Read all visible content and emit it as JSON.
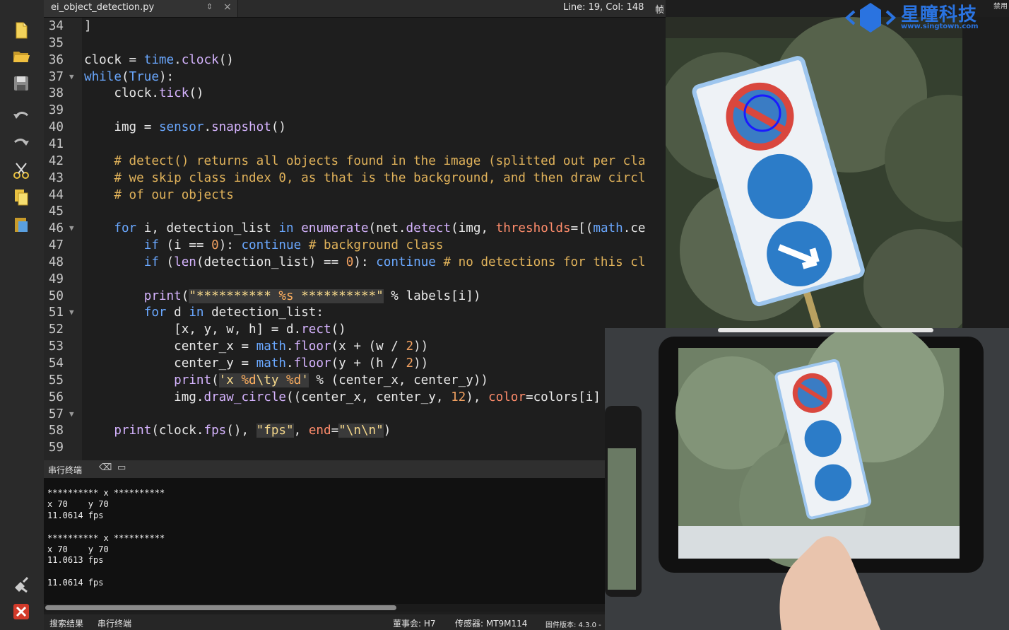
{
  "tab": {
    "title": "ei_object_detection.py",
    "arrows": "⇕",
    "close": "×"
  },
  "status_top": {
    "cursor": "Line: 19, Col: 148",
    "frame_buffer": "帧缓冲区"
  },
  "code_lines": [
    {
      "n": "34",
      "html": "]"
    },
    {
      "n": "35",
      "html": ""
    },
    {
      "n": "36",
      "html": "clock = <span class='mod'>time</span>.<span class='fn'>clock</span>()"
    },
    {
      "n": "37",
      "fold": true,
      "html": "<span class='kw'>while</span>(<span class='kw'>True</span>):"
    },
    {
      "n": "38",
      "html": "    clock.<span class='fn'>tick</span>()"
    },
    {
      "n": "39",
      "html": ""
    },
    {
      "n": "40",
      "html": "    img = <span class='mod'>sensor</span>.<span class='fn'>snapshot</span>()"
    },
    {
      "n": "41",
      "html": ""
    },
    {
      "n": "42",
      "html": "    <span class='cm'># detect() returns all objects found in the image (splitted out per cla</span>"
    },
    {
      "n": "43",
      "html": "    <span class='cm'># we skip class index 0, as that is the background, and then draw circl</span>"
    },
    {
      "n": "44",
      "html": "    <span class='cm'># of our objects</span>"
    },
    {
      "n": "45",
      "html": ""
    },
    {
      "n": "46",
      "fold": true,
      "html": "    <span class='kw'>for</span> i, detection_list <span class='kw'>in</span> <span class='fn'>enumerate</span>(net.<span class='fn'>detect</span>(img, <span class='par'>thresholds</span>=[(<span class='mod'>math</span>.ce"
    },
    {
      "n": "47",
      "html": "        <span class='kw'>if</span> (i == <span class='num'>0</span>): <span class='kw'>continue</span> <span class='cm'># background class</span>"
    },
    {
      "n": "48",
      "html": "        <span class='kw'>if</span> (<span class='fn'>len</span>(detection_list) == <span class='num'>0</span>): <span class='kw'>continue</span> <span class='cm'># no detections for this cl</span>"
    },
    {
      "n": "49",
      "html": ""
    },
    {
      "n": "50",
      "html": "        <span class='fn'>print</span>(<span class='str'>\"********** </span><span class='str fmt'>%s</span><span class='str'> **********\"</span> % labels[i])"
    },
    {
      "n": "51",
      "fold": true,
      "html": "        <span class='kw'>for</span> d <span class='kw'>in</span> detection_list:"
    },
    {
      "n": "52",
      "html": "            [x, y, w, h] = d.<span class='fn'>rect</span>()"
    },
    {
      "n": "53",
      "html": "            center_x = <span class='mod'>math</span>.<span class='fn'>floor</span>(x + (w / <span class='num'>2</span>))"
    },
    {
      "n": "54",
      "html": "            center_y = <span class='mod'>math</span>.<span class='fn'>floor</span>(y + (h / <span class='num'>2</span>))"
    },
    {
      "n": "55",
      "html": "            <span class='fn'>print</span>(<span class='str'>'x </span><span class='str fmt'>%d</span><span class='str'>\\ty </span><span class='str fmt'>%d</span><span class='str'>'</span> % (center_x, center_y))"
    },
    {
      "n": "56",
      "html": "            img.<span class='fn'>draw_circle</span>((center_x, center_y, <span class='num'>12</span>), <span class='par'>color</span>=colors[i]"
    },
    {
      "n": "57",
      "fold": true,
      "html": ""
    },
    {
      "n": "58",
      "html": "    <span class='fn'>print</span>(clock.<span class='fn'>fps</span>(), <span class='str'>\"fps\"</span>, <span class='par'>end</span>=<span class='str'>\"\\n\\n\"</span>)"
    },
    {
      "n": "59",
      "html": ""
    }
  ],
  "terminal": {
    "title": "串行终端",
    "lines": [
      "********** x **********",
      "x 70    y 70",
      "11.0614 fps",
      "",
      "********** x **********",
      "x 70    y 70",
      "11.0613 fps",
      "",
      "11.0614 fps"
    ]
  },
  "status": {
    "search_results": "搜索结果",
    "serial_terminal": "串行终端",
    "board": "董事会: H7",
    "sensor": "传感器: MT9M114",
    "firmware": "固件版本: 4.3.0 -"
  },
  "logo": {
    "name": "星瞳科技",
    "url": "www.singtown.com",
    "top_right": "禁用"
  },
  "colors": {
    "editor_bg": "#1e1e1e",
    "keyword": "#6aa8ff",
    "comment": "#e0b25a",
    "detection_circle": "#1a1aff"
  }
}
